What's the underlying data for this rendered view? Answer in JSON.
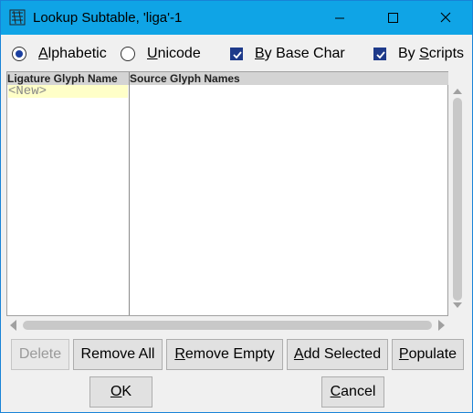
{
  "window": {
    "title": "Lookup Subtable, 'liga'-1",
    "title_bar_color": "#0fa4e6",
    "icons": [
      "app-icon",
      "minimize-icon",
      "maximize-icon",
      "close-icon"
    ]
  },
  "options": {
    "alphabetic": {
      "label": "Alphabetic",
      "mnemonic": "A",
      "rest": "lphabetic",
      "checked": true
    },
    "unicode": {
      "label": "Unicode",
      "mnemonic": "U",
      "rest": "nicode",
      "checked": false
    },
    "by_base_char": {
      "label": "By Base Char",
      "mnemonic": "B",
      "rest": "y Base Char",
      "checked": true
    },
    "by_scripts": {
      "label": "By Scripts",
      "prefix": "By ",
      "mnemonic": "S",
      "rest": "cripts",
      "checked": true
    }
  },
  "table": {
    "columns": [
      "Ligature Glyph Name",
      "Source Glyph Names"
    ],
    "rows": [
      {
        "ligature": "<New>",
        "sources": ""
      }
    ],
    "new_row_color": "#ffffc8"
  },
  "buttons": {
    "delete": {
      "label": "Delete",
      "enabled": false
    },
    "remove_all": {
      "label": "Remove All"
    },
    "remove_empty": {
      "label": "Remove Empty",
      "mnemonic": "R",
      "rest": "emove Empty"
    },
    "add_selected": {
      "label": "Add Selected",
      "mnemonic": "A",
      "rest": "dd Selected"
    },
    "populate": {
      "label": "Populate",
      "mnemonic": "P",
      "rest": "opulate"
    },
    "ok": {
      "label": "OK",
      "mnemonic": "O",
      "rest": "K"
    },
    "cancel": {
      "label": "Cancel",
      "mnemonic": "C",
      "rest": "ancel"
    }
  },
  "colors": {
    "checkbox_fill": "#1e3a8a",
    "radio_dot": "#1a3fa0"
  }
}
